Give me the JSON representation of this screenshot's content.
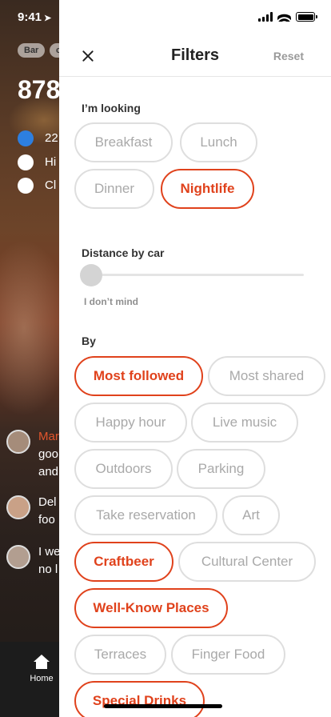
{
  "background": {
    "time": "9:41",
    "chips": [
      "Bar",
      "c"
    ],
    "big_number": "878",
    "rows": [
      "22",
      "Hi",
      "Cl"
    ],
    "comments": [
      {
        "name": "Mar",
        "lines": [
          "goo",
          "and"
        ]
      },
      {
        "name": "",
        "lines": [
          "Del",
          "foo"
        ]
      },
      {
        "name": "",
        "lines": [
          "I we",
          "no l"
        ]
      }
    ],
    "tabbar": {
      "home_label": "Home"
    }
  },
  "header": {
    "title": "Filters",
    "reset_label": "Reset"
  },
  "looking": {
    "title": "I’m looking",
    "options": [
      {
        "label": "Breakfast",
        "selected": false
      },
      {
        "label": "Lunch",
        "selected": false
      },
      {
        "label": "Dinner",
        "selected": false
      },
      {
        "label": "Nightlife",
        "selected": true
      }
    ]
  },
  "distance": {
    "title": "Distance by car",
    "value_label": "I don’t mind",
    "level": 0
  },
  "by": {
    "title": "By",
    "options": [
      {
        "label": "Most followed",
        "selected": true
      },
      {
        "label": "Most shared",
        "selected": false
      },
      {
        "label": "Happy hour",
        "selected": false
      },
      {
        "label": "Live music",
        "selected": false
      },
      {
        "label": "Outdoors",
        "selected": false
      },
      {
        "label": "Parking",
        "selected": false
      },
      {
        "label": "Take reservation",
        "selected": false
      },
      {
        "label": "Art",
        "selected": false
      },
      {
        "label": "Craftbeer",
        "selected": true
      },
      {
        "label": "Cultural Center",
        "selected": false
      },
      {
        "label": "Well-Know Places",
        "selected": true
      },
      {
        "label": "Terraces",
        "selected": false
      },
      {
        "label": "Finger Food",
        "selected": false
      },
      {
        "label": "Special Drinks",
        "selected": true
      }
    ]
  },
  "colors": {
    "accent": "#e0421c",
    "chip_border": "#dedede",
    "chip_text": "#a9a9a9"
  }
}
